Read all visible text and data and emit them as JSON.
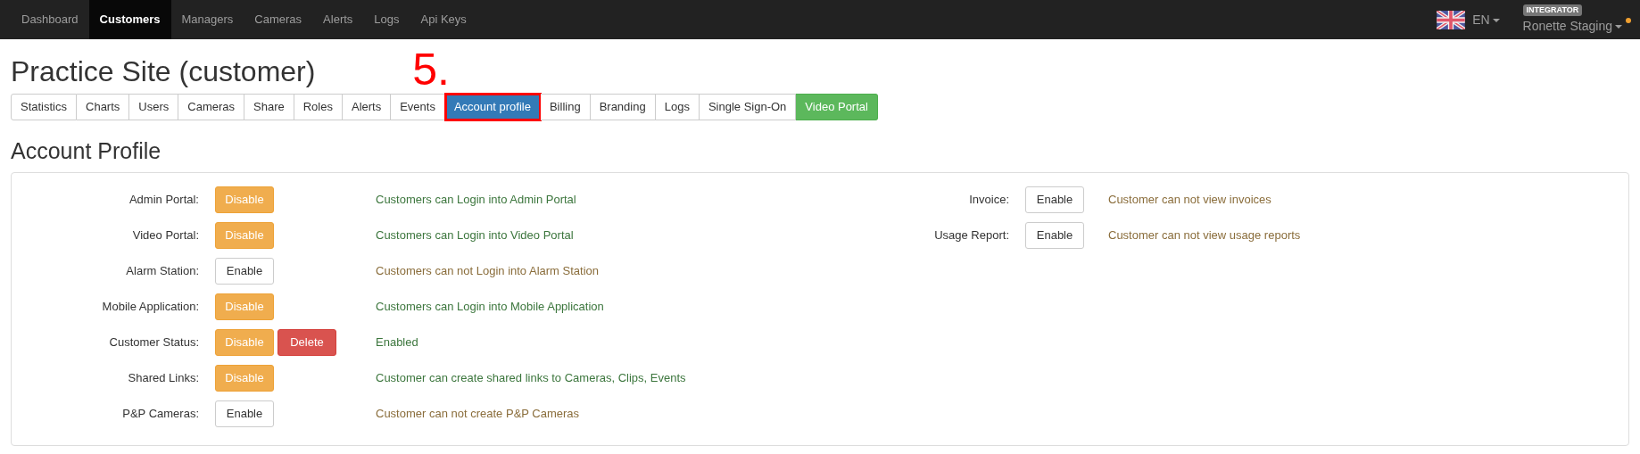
{
  "navbar": {
    "items": [
      {
        "label": "Dashboard",
        "selected": false
      },
      {
        "label": "Customers",
        "selected": true
      },
      {
        "label": "Managers",
        "selected": false
      },
      {
        "label": "Cameras",
        "selected": false
      },
      {
        "label": "Alerts",
        "selected": false
      },
      {
        "label": "Logs",
        "selected": false
      },
      {
        "label": "Api Keys",
        "selected": false
      }
    ],
    "language": {
      "label": "EN"
    },
    "user": {
      "role": "INTEGRATOR",
      "name": "Ronette Staging",
      "notification": true
    }
  },
  "page_title": "Practice Site (customer)",
  "annotation": {
    "label": "5."
  },
  "tabs": [
    {
      "label": "Statistics",
      "selected": false,
      "kind": "plain",
      "annotated": false
    },
    {
      "label": "Charts",
      "selected": false,
      "kind": "plain",
      "annotated": false
    },
    {
      "label": "Users",
      "selected": false,
      "kind": "plain",
      "annotated": false
    },
    {
      "label": "Cameras",
      "selected": false,
      "kind": "plain",
      "annotated": false
    },
    {
      "label": "Share",
      "selected": false,
      "kind": "plain",
      "annotated": false
    },
    {
      "label": "Roles",
      "selected": false,
      "kind": "plain",
      "annotated": false
    },
    {
      "label": "Alerts",
      "selected": false,
      "kind": "plain",
      "annotated": false
    },
    {
      "label": "Events",
      "selected": false,
      "kind": "plain",
      "annotated": false
    },
    {
      "label": "Account profile",
      "selected": true,
      "kind": "plain",
      "annotated": true
    },
    {
      "label": "Billing",
      "selected": false,
      "kind": "plain",
      "annotated": false
    },
    {
      "label": "Branding",
      "selected": false,
      "kind": "plain",
      "annotated": false
    },
    {
      "label": "Logs",
      "selected": false,
      "kind": "plain",
      "annotated": false
    },
    {
      "label": "Single Sign-On",
      "selected": false,
      "kind": "plain",
      "annotated": false
    },
    {
      "label": "Video Portal",
      "selected": false,
      "kind": "highlight",
      "annotated": false
    }
  ],
  "section_title": "Account Profile",
  "settings_columns": [
    [
      {
        "label": "Admin Portal:",
        "buttons": [
          {
            "label": "Disable",
            "kind": "warning"
          }
        ],
        "description": "Customers can Login into Admin Portal",
        "color": "#3c763d"
      },
      {
        "label": "Video Portal:",
        "buttons": [
          {
            "label": "Disable",
            "kind": "warning"
          }
        ],
        "description": "Customers can Login into Video Portal",
        "color": "#3c763d"
      },
      {
        "label": "Alarm Station:",
        "buttons": [
          {
            "label": "Enable",
            "kind": "plain"
          }
        ],
        "description": "Customers can not Login into Alarm Station",
        "color": "#8a6d3b"
      },
      {
        "label": "Mobile Application:",
        "buttons": [
          {
            "label": "Disable",
            "kind": "warning"
          }
        ],
        "description": "Customers can Login into Mobile Application",
        "color": "#3c763d"
      },
      {
        "label": "Customer Status:",
        "buttons": [
          {
            "label": "Disable",
            "kind": "warning"
          },
          {
            "label": "Delete",
            "kind": "danger"
          }
        ],
        "description": "Enabled",
        "color": "#3c763d"
      },
      {
        "label": "Shared Links:",
        "buttons": [
          {
            "label": "Disable",
            "kind": "warning"
          }
        ],
        "description": "Customer can create shared links to Cameras, Clips, Events",
        "color": "#3c763d"
      },
      {
        "label": "P&P Cameras:",
        "buttons": [
          {
            "label": "Enable",
            "kind": "plain"
          }
        ],
        "description": "Customer can not create P&P Cameras",
        "color": "#8a6d3b"
      }
    ],
    [
      {
        "label": "Invoice:",
        "buttons": [
          {
            "label": "Enable",
            "kind": "plain"
          }
        ],
        "description": "Customer can not view invoices",
        "color": "#8a6d3b"
      },
      {
        "label": "Usage Report:",
        "buttons": [
          {
            "label": "Enable",
            "kind": "plain"
          }
        ],
        "description": "Customer can not view usage reports",
        "color": "#8a6d3b"
      }
    ]
  ]
}
